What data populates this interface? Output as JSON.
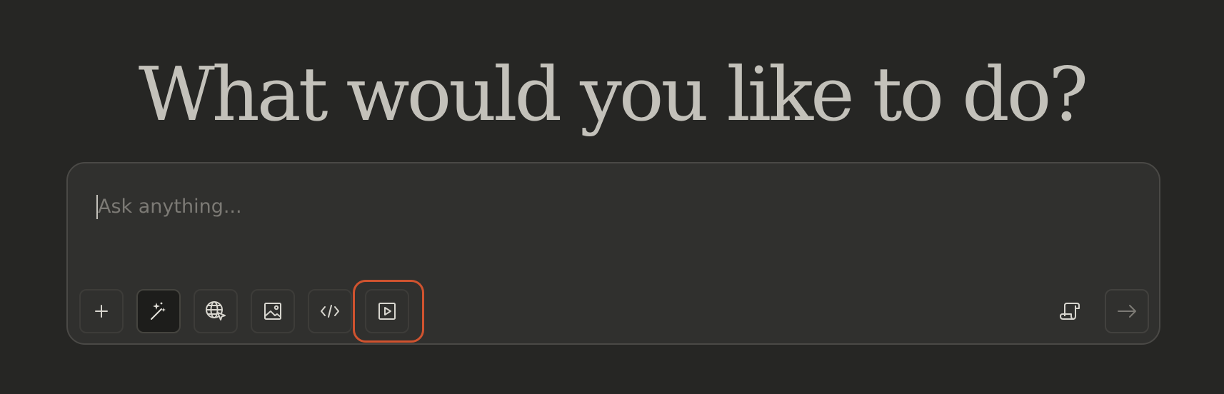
{
  "heading": "What would you like to do?",
  "composer": {
    "placeholder": "Ask anything...",
    "value": ""
  },
  "toolbar": {
    "buttons": [
      {
        "name": "add-button",
        "icon": "plus-icon"
      },
      {
        "name": "magic-wand-button",
        "icon": "magic-wand-icon",
        "active": true
      },
      {
        "name": "web-search-button",
        "icon": "globe-cursor-icon"
      },
      {
        "name": "image-button",
        "icon": "image-icon"
      },
      {
        "name": "code-button",
        "icon": "code-icon"
      },
      {
        "name": "video-button",
        "icon": "play-icon",
        "highlighted": true
      }
    ],
    "right_buttons": [
      {
        "name": "script-button",
        "icon": "scroll-icon"
      },
      {
        "name": "send-button",
        "icon": "arrow-right-icon"
      }
    ]
  },
  "colors": {
    "background": "#262624",
    "composer_bg": "#30302e",
    "text": "#c3c1ba",
    "highlight": "#d0532f"
  }
}
